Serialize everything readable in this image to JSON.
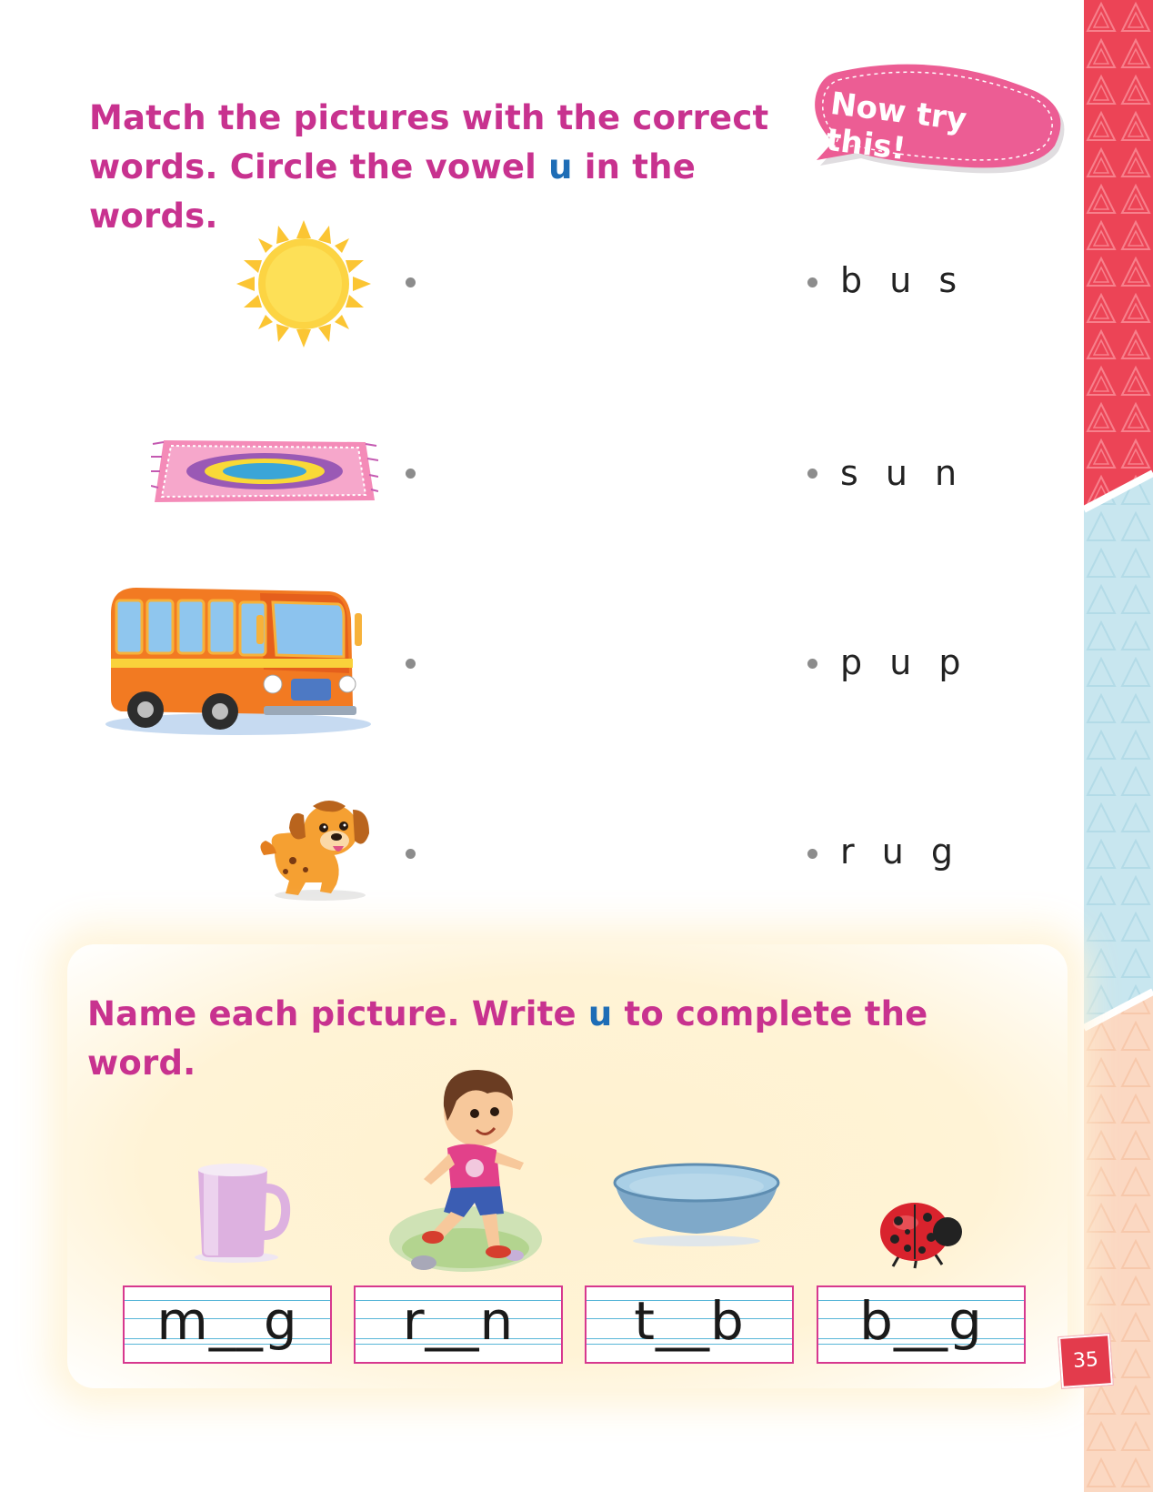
{
  "heading_match_line1": "Match the pictures with the correct",
  "heading_match_line2_before": "words. Circle the vowel ",
  "heading_match_vowel": "u",
  "heading_match_line2_after": " in the words.",
  "bubble_text": "Now try this!",
  "match_words": [
    "b u s",
    "s u n",
    "p u p",
    "r u g"
  ],
  "heading_write_before": "Name each picture. Write ",
  "heading_write_vowel": "u",
  "heading_write_after": " to complete the word.",
  "write_words": [
    "m__g",
    "r__n",
    "t__b",
    "b__g"
  ],
  "page_number": "35",
  "colors": {
    "heading": "#c8328f",
    "vowel": "#1e6db6",
    "bubble": "#ec5d94",
    "strip_red": "#ec4456",
    "strip_blue": "#c8e6ef",
    "strip_peach": "#fbd8c2"
  }
}
